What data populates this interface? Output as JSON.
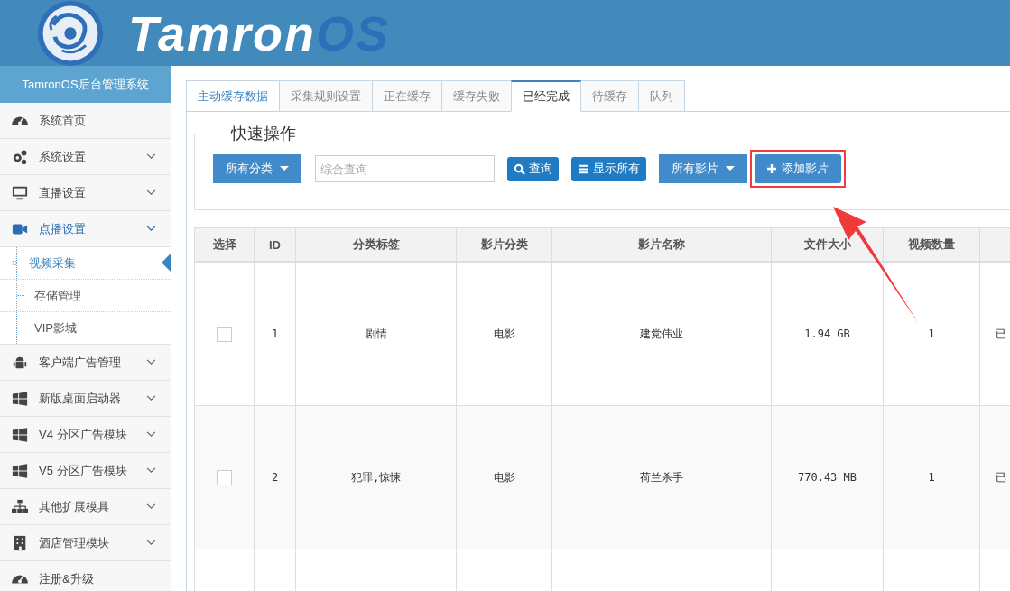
{
  "header": {
    "logo_text_parts": [
      "Tamron",
      "OS"
    ]
  },
  "sidebar": {
    "title": "TamronOS后台管理系统",
    "items": [
      {
        "label": "系统首页",
        "has_submenu": false,
        "expanded": false
      },
      {
        "label": "系统设置",
        "has_submenu": true,
        "expanded": false
      },
      {
        "label": "直播设置",
        "has_submenu": true,
        "expanded": false
      },
      {
        "label": "点播设置",
        "has_submenu": true,
        "expanded": true,
        "children": [
          {
            "label": "视频采集",
            "selected": true
          },
          {
            "label": "存储管理",
            "selected": false
          },
          {
            "label": "VIP影城",
            "selected": false
          }
        ]
      },
      {
        "label": "客户端广告管理",
        "has_submenu": true,
        "expanded": false
      },
      {
        "label": "新版桌面启动器",
        "has_submenu": true,
        "expanded": false
      },
      {
        "label": "V4 分区广告模块",
        "has_submenu": true,
        "expanded": false
      },
      {
        "label": "V5 分区广告模块",
        "has_submenu": true,
        "expanded": false
      },
      {
        "label": "其他扩展模具",
        "has_submenu": true,
        "expanded": false
      },
      {
        "label": "酒店管理模块",
        "has_submenu": true,
        "expanded": false
      },
      {
        "label": "注册&升级",
        "has_submenu": false,
        "expanded": false
      }
    ]
  },
  "tabs": [
    {
      "label": "主动缓存数据",
      "selected": false,
      "hover": true
    },
    {
      "label": "采集规则设置",
      "selected": false,
      "hover": false
    },
    {
      "label": "正在缓存",
      "selected": false,
      "hover": false
    },
    {
      "label": "缓存失败",
      "selected": false,
      "hover": false
    },
    {
      "label": "已经完成",
      "selected": true,
      "hover": false
    },
    {
      "label": "待缓存",
      "selected": false,
      "hover": false
    },
    {
      "label": "队列",
      "selected": false,
      "hover": false
    }
  ],
  "quick_actions": {
    "legend": "快速操作",
    "category_dropdown": "所有分类",
    "search": {
      "placeholder": "综合查询"
    },
    "query_button": "查询",
    "show_all_button": "显示所有",
    "film_dropdown": "所有影片",
    "add_button": "添加影片",
    "add_button_highlighted": true
  },
  "table": {
    "columns": [
      "选择",
      "ID",
      "分类标签",
      "影片分类",
      "影片名称",
      "文件大小",
      "视频数量"
    ],
    "rows": [
      {
        "checked": false,
        "id": "1",
        "tags": "剧情",
        "category": "电影",
        "name": "建党伟业",
        "size": "1.94 GB",
        "count": "1",
        "column_8": "已"
      },
      {
        "checked": false,
        "id": "2",
        "tags": "犯罪,惊悚",
        "category": "电影",
        "name": "荷兰杀手",
        "size": "770.43 MB",
        "count": "1",
        "column_8": "已"
      }
    ]
  }
}
